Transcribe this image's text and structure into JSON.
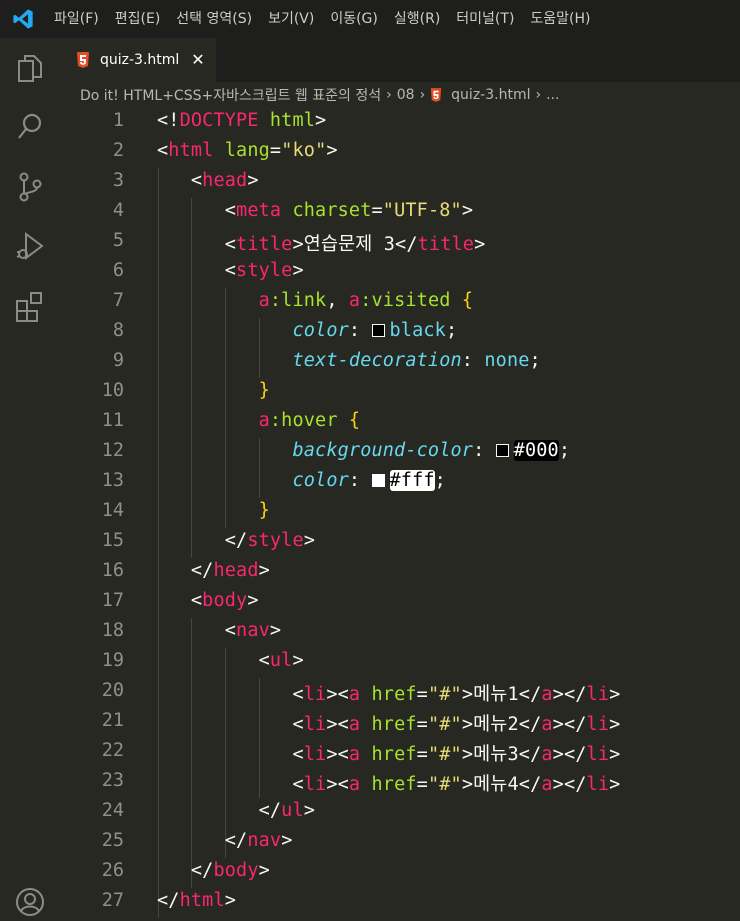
{
  "menubar": {
    "items": [
      "파일(F)",
      "편집(E)",
      "선택 영역(S)",
      "보기(V)",
      "이동(G)",
      "실행(R)",
      "터미널(T)",
      "도움말(H)"
    ]
  },
  "tab": {
    "filename": "quiz-3.html",
    "close_glyph": "✕"
  },
  "breadcrumb": {
    "segments": [
      "Do it! HTML+CSS+자바스크립트 웹 표준의 정석",
      "08",
      "quiz-3.html",
      "..."
    ],
    "separator": "›"
  },
  "editor": {
    "line_numbers": [
      "1",
      "2",
      "3",
      "4",
      "5",
      "6",
      "7",
      "8",
      "9",
      "10",
      "11",
      "12",
      "13",
      "14",
      "15",
      "16",
      "17",
      "18",
      "19",
      "20",
      "21",
      "22",
      "23",
      "24",
      "25",
      "26",
      "27"
    ],
    "title_text": "연습문제 3",
    "css": {
      "selector_1": "a:link, a:visited",
      "selector_2": "a:hover",
      "color_prop": "color",
      "text_decoration_prop": "text-decoration",
      "background_color_prop": "background-color",
      "black_value": "black",
      "none_value": "none",
      "hex_black": "#000",
      "hex_white": "#fff"
    },
    "menu_items": [
      "메뉴1",
      "메뉴2",
      "메뉴3",
      "메뉴4"
    ]
  },
  "colors": {
    "editor_bg": "#272822",
    "menubar_bg": "#1e1f1c",
    "tag": "#f92672",
    "attribute": "#a6e22e",
    "string": "#e6db74",
    "property": "#66d9ef",
    "bracket": "#fcd117",
    "line_number": "#8f908a",
    "accent_logo": "#23a9f2",
    "html_icon": "#e44d26"
  },
  "icons": [
    "vscode-logo-icon",
    "explorer-icon",
    "search-icon",
    "source-control-icon",
    "run-debug-icon",
    "extensions-icon",
    "account-icon",
    "html5-file-icon"
  ]
}
